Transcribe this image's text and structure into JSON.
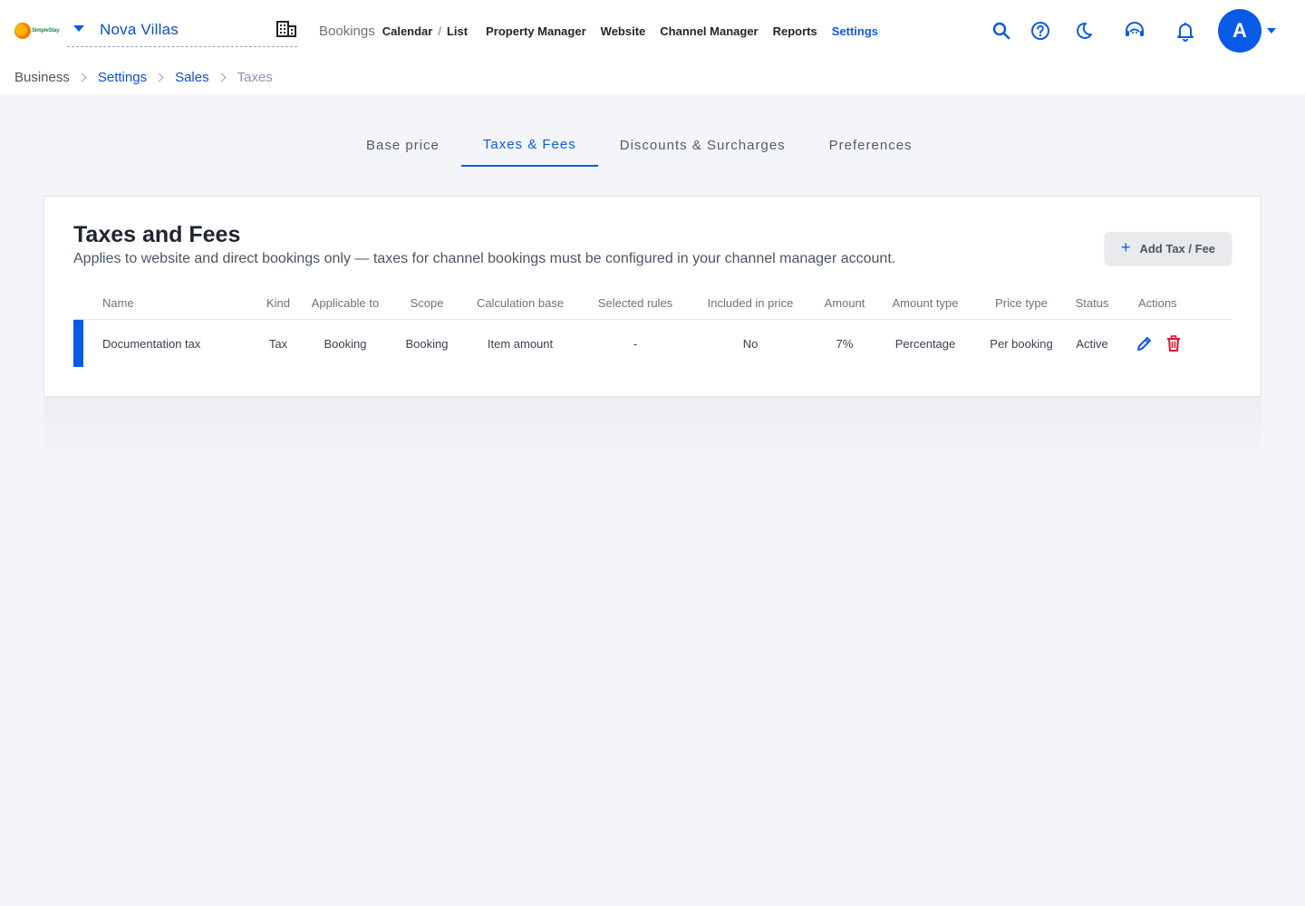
{
  "brand": {
    "logo_text": "SimpleStay"
  },
  "header": {
    "property_name": "Nova Villas",
    "nav": {
      "bookings_label": "Bookings",
      "calendar_label": "Calendar",
      "separator": "/",
      "list_label": "List",
      "items": [
        "Property Manager",
        "Website",
        "Channel Manager",
        "Reports",
        "Settings"
      ],
      "active_item": "Settings"
    },
    "icons": [
      "search-icon",
      "help-icon",
      "dark-mode-icon",
      "support-icon",
      "notifications-icon"
    ],
    "avatar_letter": "A"
  },
  "breadcrumb": [
    "Business",
    "Settings",
    "Sales",
    "Taxes"
  ],
  "tabs": {
    "items": [
      "Base price",
      "Taxes & Fees",
      "Discounts & Surcharges",
      "Preferences"
    ],
    "active": "Taxes & Fees"
  },
  "card": {
    "title": "Taxes and Fees",
    "subtitle": "Applies to website and direct bookings only — taxes for channel bookings must be configured in your channel manager account.",
    "add_button_label": "Add Tax / Fee"
  },
  "table": {
    "columns": [
      "Name",
      "Kind",
      "Applicable to",
      "Scope",
      "Calculation base",
      "Selected rules",
      "Included in price",
      "Amount",
      "Amount type",
      "Price type",
      "Status",
      "Actions"
    ],
    "rows": [
      {
        "name": "Documentation tax",
        "kind": "Tax",
        "applicable_to": "Booking",
        "scope": "Booking",
        "calculation_base": "Item amount",
        "selected_rules": "-",
        "included_in_price": "No",
        "amount": "7%",
        "amount_type": "Percentage",
        "price_type": "Per booking",
        "status": "Active"
      }
    ]
  },
  "colors": {
    "accent": "#0a5ae8",
    "delete": "#e0102f",
    "background": "#f4f5f8"
  }
}
